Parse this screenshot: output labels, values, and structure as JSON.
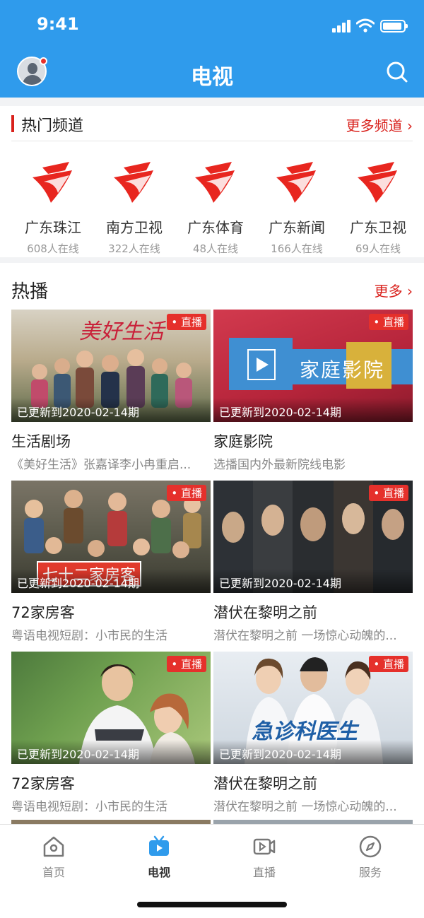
{
  "status_bar": {
    "time": "9:41"
  },
  "nav": {
    "title": "电视"
  },
  "hot_channels": {
    "title": "热门频道",
    "more": "更多频道 ›",
    "items": [
      {
        "name": "广东珠江",
        "online": "608人在线"
      },
      {
        "name": "南方卫视",
        "online": "322人在线"
      },
      {
        "name": "广东体育",
        "online": "48人在线"
      },
      {
        "name": "广东新闻",
        "online": "166人在线"
      },
      {
        "name": "广东卫视",
        "online": "69人在线"
      }
    ]
  },
  "hot_play": {
    "title": "热播",
    "more": "更多 ›",
    "live_badge": "• 直播",
    "cards": [
      {
        "title": "生活剧场",
        "desc": "《美好生活》张嘉译李小冉重启...",
        "updated": "已更新到2020-02-14期",
        "poster_text": "美好生活"
      },
      {
        "title": "家庭影院",
        "desc": "选播国内外最新院线电影",
        "updated": "已更新到2020-02-14期",
        "poster_text": "家庭影院"
      },
      {
        "title": "72家房客",
        "desc": "粤语电视短剧：小市民的生活",
        "updated": "已更新到2020-02-14期",
        "poster_text": "七十二家房客"
      },
      {
        "title": "潜伏在黎明之前",
        "desc": "潜伏在黎明之前 一场惊心动魄的...",
        "updated": "已更新到2020-02-14期",
        "poster_text": ""
      },
      {
        "title": "72家房客",
        "desc": "粤语电视短剧：小市民的生活",
        "updated": "已更新到2020-02-14期",
        "poster_text": ""
      },
      {
        "title": "潜伏在黎明之前",
        "desc": "潜伏在黎明之前 一场惊心动魄的...",
        "updated": "已更新到2020-02-14期",
        "poster_text": "急诊科医生"
      }
    ]
  },
  "tabbar": {
    "items": [
      {
        "label": "首页",
        "icon": "home-icon"
      },
      {
        "label": "电视",
        "icon": "tv-icon",
        "active": true
      },
      {
        "label": "直播",
        "icon": "live-video-icon"
      },
      {
        "label": "服务",
        "icon": "compass-icon"
      }
    ]
  },
  "colors": {
    "primary": "#2f9bec",
    "accent": "#d9211c",
    "live": "#e5302b"
  }
}
